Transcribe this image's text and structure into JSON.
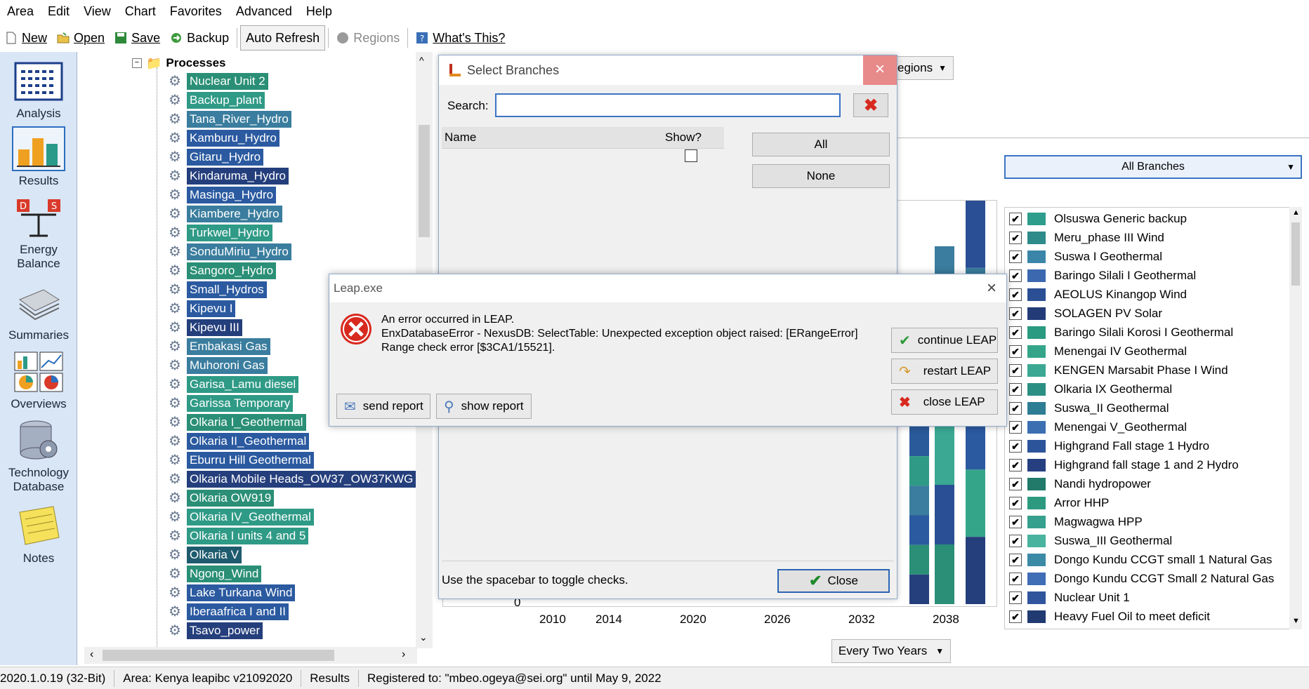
{
  "menu": [
    "Area",
    "Edit",
    "View",
    "Chart",
    "Favorites",
    "Advanced",
    "Help"
  ],
  "toolbar": {
    "new": "New",
    "open": "Open",
    "save": "Save",
    "backup": "Backup",
    "auto_refresh": "Auto Refresh",
    "regions": "Regions",
    "whats_this": "What's This?"
  },
  "sidebar": [
    {
      "label": "Analysis"
    },
    {
      "label": "Results"
    },
    {
      "label": "Energy Balance"
    },
    {
      "label": "Summaries"
    },
    {
      "label": "Overviews"
    },
    {
      "label": "Technology Database"
    },
    {
      "label": "Notes"
    }
  ],
  "tree": {
    "folder": "Processes",
    "items": [
      "Nuclear Unit 2",
      "Backup_plant",
      "Tana_River_Hydro",
      "Kamburu_Hydro",
      "Gitaru_Hydro",
      "Kindaruma_Hydro",
      "Masinga_Hydro",
      "Kiambere_Hydro",
      "Turkwel_Hydro",
      "SonduMiriu_Hydro",
      "Sangoro_Hydro",
      "Small_Hydros",
      "Kipevu I",
      "Kipevu III",
      "Embakasi Gas",
      "Muhoroni Gas",
      "Garisa_Lamu diesel",
      "Garissa Temporary",
      "Olkaria I_Geothermal",
      "Olkaria II_Geothermal",
      "Eburru Hill Geothermal",
      "Olkaria Mobile Heads_OW37_OW37KWG",
      "Olkaria OW919",
      "Olkaria IV_Geothermal",
      "Olkaria I units 4 and 5",
      "Olkaria V",
      "Ngong_Wind",
      "Lake Turkana Wind",
      "Iberaafrica I and II",
      "Tsavo_power"
    ],
    "colors": [
      "c6",
      "c1",
      "c2",
      "c3",
      "c3",
      "c4",
      "c3",
      "c2",
      "c1",
      "c2",
      "c6",
      "c3",
      "c3",
      "c4",
      "c2",
      "c2",
      "c1",
      "c1",
      "c6",
      "c3",
      "c3",
      "c4",
      "c6",
      "c1",
      "c1",
      "c5",
      "c6",
      "c3",
      "c3",
      "c4"
    ]
  },
  "right": {
    "regions_label": "egions",
    "all_branches": "All Branches",
    "every_two_years": "Every Two Years",
    "y_zero": "0",
    "x_ticks": [
      "2010",
      "2014",
      "2020",
      "2026",
      "2032",
      "2038"
    ],
    "legend": [
      {
        "label": "Olsuswa Generic backup",
        "color": "#2e9d8c"
      },
      {
        "label": "Meru_phase III Wind",
        "color": "#2f8a8a"
      },
      {
        "label": "Suswa I Geothermal",
        "color": "#3b86a8"
      },
      {
        "label": "Baringo Silali I Geothermal",
        "color": "#3c68b0"
      },
      {
        "label": "AEOLUS Kinangop Wind",
        "color": "#2b4f94"
      },
      {
        "label": "SOLAGEN PV Solar",
        "color": "#233c78"
      },
      {
        "label": "Baringo Silali Korosi  I Geothermal",
        "color": "#2a9a80"
      },
      {
        "label": "Menengai IV Geothermal",
        "color": "#35a58a"
      },
      {
        "label": "KENGEN Marsabit Phase I Wind",
        "color": "#3aa893"
      },
      {
        "label": "Olkaria IX Geothermal",
        "color": "#2b8f84"
      },
      {
        "label": "Suswa_II Geothermal",
        "color": "#2d7d94"
      },
      {
        "label": "Menengai V_Geothermal",
        "color": "#3c6fb2"
      },
      {
        "label": "Highgrand Fall stage 1 Hydro",
        "color": "#2c549a"
      },
      {
        "label": "Highgrand fall stage 1 and 2 Hydro",
        "color": "#253f80"
      },
      {
        "label": "Nandi hydropower",
        "color": "#217a6a"
      },
      {
        "label": "Arror HHP",
        "color": "#2d9a80"
      },
      {
        "label": "Magwagwa HPP",
        "color": "#35a08e"
      },
      {
        "label": "Suswa_III Geothermal",
        "color": "#48b39e"
      },
      {
        "label": "Dongo Kundu CCGT small 1 Natural Gas",
        "color": "#3b8aa6"
      },
      {
        "label": "Dongo Kundu CCGT Small 2 Natural Gas",
        "color": "#3f6db6"
      },
      {
        "label": "Nuclear Unit 1",
        "color": "#30559c"
      },
      {
        "label": "Heavy Fuel Oil to meet deficit",
        "color": "#223a72"
      }
    ]
  },
  "status": {
    "version": "2020.1.0.19 (32-Bit)",
    "area": "Area: Kenya leapibc v21092020",
    "view": "Results",
    "registered": "Registered to: \"mbeo.ogeya@sei.org\" until May 9, 2022"
  },
  "select_branches": {
    "title": "Select Branches",
    "search_label": "Search:",
    "search_value": "",
    "col_name": "Name",
    "col_show": "Show?",
    "all": "All",
    "none": "None",
    "hint": "Use the spacebar to toggle checks.",
    "close": "Close"
  },
  "error_dialog": {
    "title": "Leap.exe",
    "line1": "An error occurred in LEAP.",
    "line2": "EnxDatabaseError - NexusDB: SelectTable: Unexpected exception object raised: [ERangeError]",
    "line3": "Range check error [$3CA1/15521].",
    "continue": "continue LEAP",
    "restart": "restart LEAP",
    "close": "close LEAP",
    "send": "send report",
    "show": "show report"
  }
}
